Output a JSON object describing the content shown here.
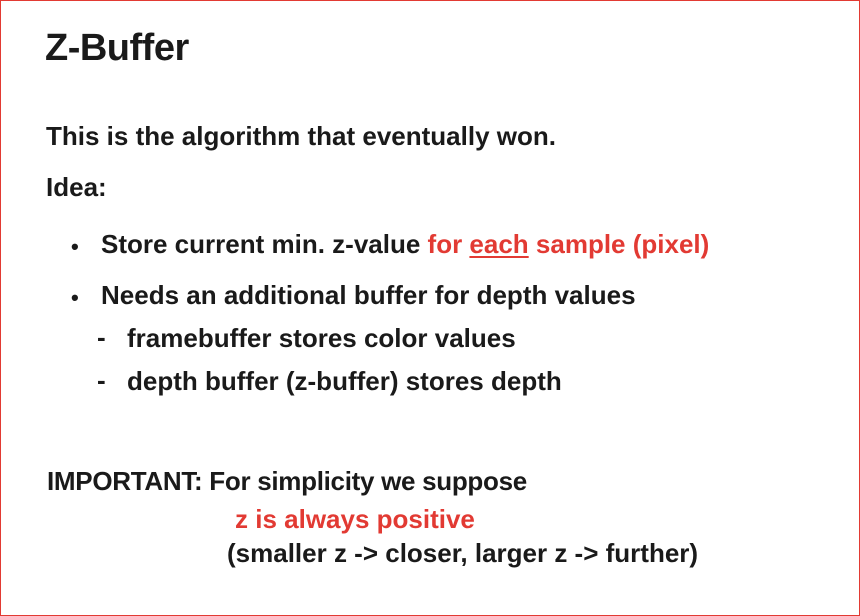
{
  "slide": {
    "title": "Z-Buffer",
    "intro": "This is the algorithm that eventually won.",
    "idea_label": "Idea:",
    "bullets": [
      {
        "marker": "•",
        "text_before": "Store current min. z-value ",
        "red_for": "for ",
        "red_each": "each",
        "red_after": " sample  (pixel)"
      },
      {
        "marker": "•",
        "text": "Needs an additional buffer for depth  values"
      }
    ],
    "sub_items": [
      {
        "marker": "-",
        "text": "framebuffer stores color values"
      },
      {
        "marker": "-",
        "text": "depth buffer (z-buffer) stores depth"
      }
    ],
    "important": "IMPORTANT: For simplicity we  suppose",
    "z_positive": "z is always positive",
    "closer_further": "(smaller z -> closer, larger z ->  further)"
  },
  "colors": {
    "accent_red": "#e23a33",
    "text": "#1a1a1a",
    "border": "#e23a33",
    "background": "#ffffff"
  }
}
